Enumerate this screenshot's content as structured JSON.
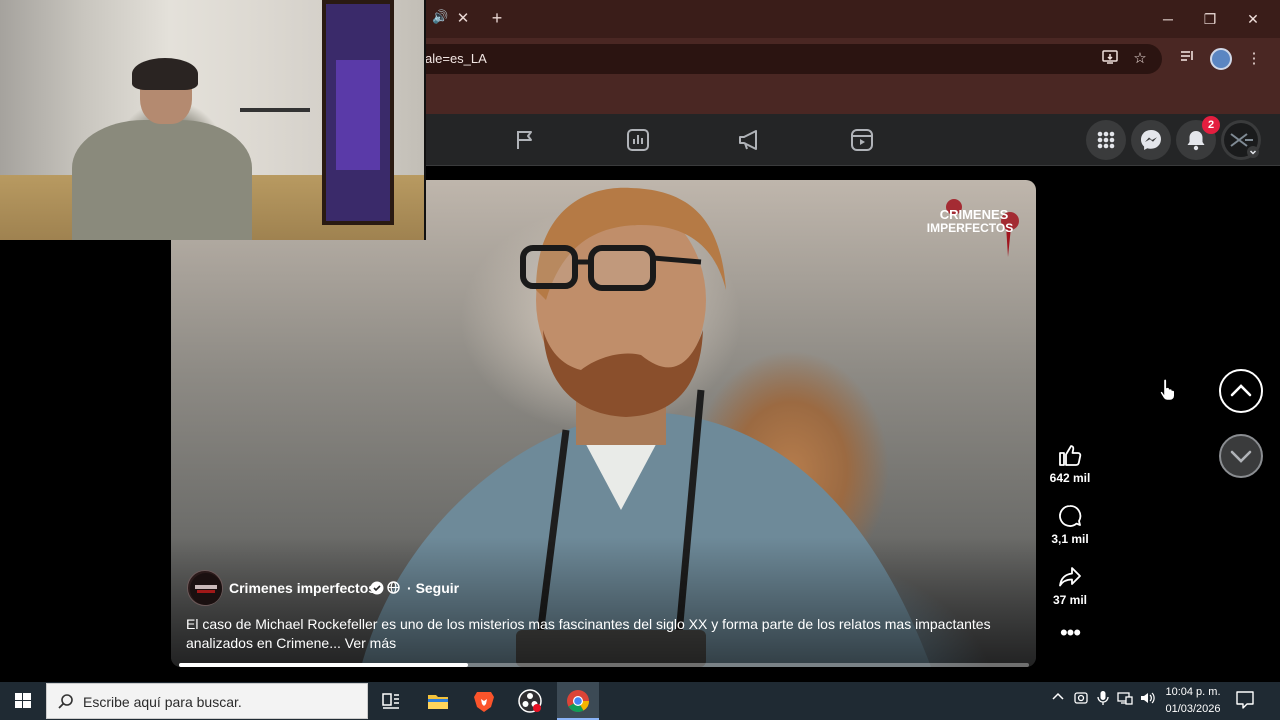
{
  "browser": {
    "url_fragment": "ale=es_LA",
    "tab_close": "✕",
    "new_tab": "+",
    "window_minimize": "─",
    "window_restore": "❐",
    "window_close": "✕"
  },
  "facebook": {
    "notification_count": "2"
  },
  "reel": {
    "page_name": "Crimenes imperfectos",
    "separator": "·",
    "follow_label": "Seguir",
    "caption": "El caso de Michael Rockefeller es uno de los misterios mas fascinantes del siglo XX y forma parte de los relatos mas impactantes analizados en Crimene...",
    "see_more": "Ver más",
    "logo_text_top": "CRIMENES",
    "logo_text_bottom": "IMPERFECTOS",
    "progress_fraction": 0.34,
    "likes": "642 mil",
    "comments": "3,1 mil",
    "shares": "37 mil"
  },
  "taskbar": {
    "search_placeholder": "Escribe aquí para buscar.",
    "time": "10:04 p. m.",
    "date": "01/03/2026"
  },
  "colors": {
    "chrome_tabbar": "#3a1d19",
    "chrome_toolbar": "#4a2723",
    "fb_header": "#242526",
    "badge_red": "#e41e3f",
    "taskbar": "#1f2a33"
  }
}
